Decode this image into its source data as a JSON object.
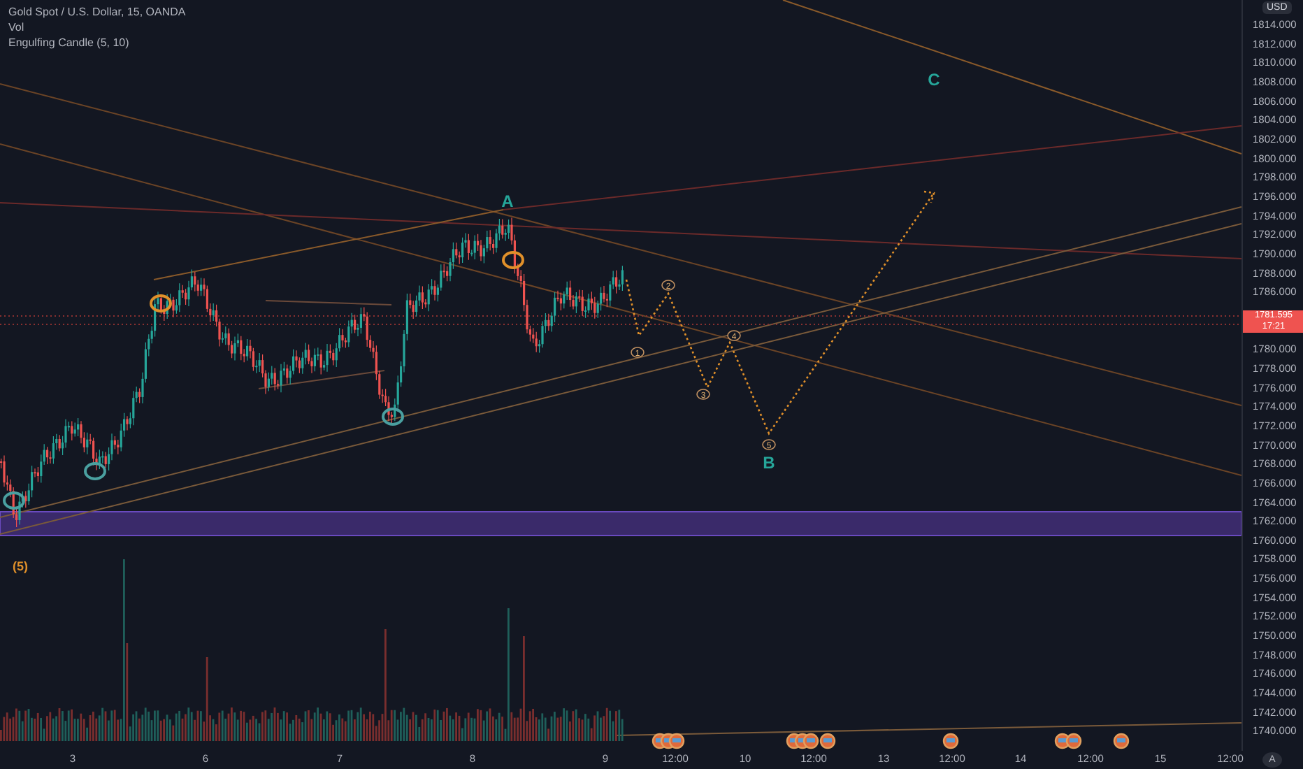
{
  "legend": {
    "symbol": "Gold Spot / U.S. Dollar, 15, OANDA",
    "indicators": [
      "Vol",
      "Engulfing Candle (5, 10)"
    ]
  },
  "indicator_value": "(5)",
  "wave_labels": [
    "A",
    "B",
    "C"
  ],
  "wave_numbers": [
    "1",
    "2",
    "3",
    "4",
    "5"
  ],
  "price_axis": {
    "currency": "USD",
    "labels_above": [
      "1814.000",
      "1812.000",
      "1810.000",
      "1808.000",
      "1806.000",
      "1804.000",
      "1802.000",
      "1800.000",
      "1798.000",
      "1796.000",
      "1794.000",
      "1792.000",
      "1790.000",
      "1788.000",
      "1786.000"
    ],
    "labels_below": [
      "1780.000",
      "1778.000",
      "1776.000",
      "1774.000",
      "1772.000",
      "1770.000",
      "1768.000",
      "1766.000",
      "1764.000",
      "1762.000",
      "1760.000",
      "1758.000",
      "1756.000",
      "1754.000",
      "1752.000",
      "1750.000",
      "1748.000",
      "1746.000",
      "1744.000",
      "1742.000",
      "1740.000"
    ],
    "last_price": "1781.595",
    "countdown": "17:21"
  },
  "time_axis": {
    "labels": [
      "3",
      "6",
      "7",
      "8",
      "9",
      "12:00",
      "10",
      "12:00",
      "13",
      "12:00",
      "14",
      "12:00",
      "15",
      "12:00"
    ],
    "auto_button": "A"
  }
}
